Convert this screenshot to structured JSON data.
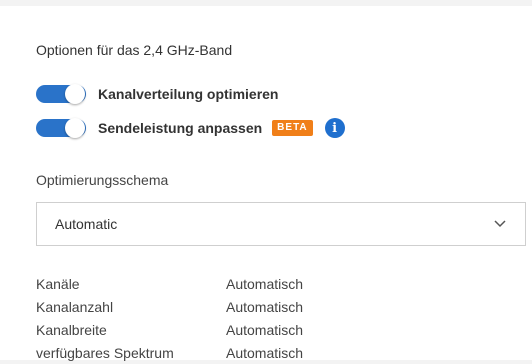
{
  "section": {
    "title": "Optionen für das 2,4 GHz-Band"
  },
  "toggles": [
    {
      "label": "Kanalverteilung optimieren",
      "on": true
    },
    {
      "label": "Sendeleistung anpassen",
      "on": true,
      "badge": "BETA"
    }
  ],
  "info_icon": "i",
  "scheme": {
    "label": "Optimierungsschema",
    "value": "Automatic"
  },
  "details": [
    {
      "key": "Kanäle",
      "value": "Automatisch"
    },
    {
      "key": "Kanalanzahl",
      "value": "Automatisch"
    },
    {
      "key": "Kanalbreite",
      "value": "Automatisch"
    },
    {
      "key": "verfügbares Spektrum",
      "value": "Automatisch"
    }
  ],
  "colors": {
    "toggle_on": "#2a73c9",
    "beta_badge": "#f07f19",
    "info_icon": "#1f6fce"
  }
}
